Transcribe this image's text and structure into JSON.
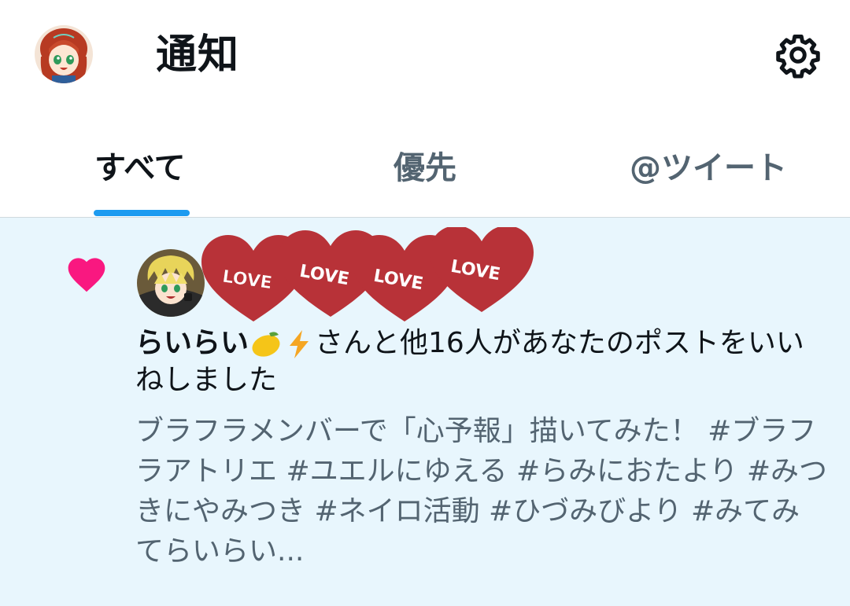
{
  "header": {
    "title": "通知",
    "profile_avatar_icon": "profile-avatar",
    "settings_icon": "gear-icon"
  },
  "tabs": [
    {
      "label": "すべて",
      "active": true
    },
    {
      "label": "優先",
      "active": false
    },
    {
      "label": "@ツイート",
      "active": false
    }
  ],
  "notification": {
    "type_icon": "heart-icon",
    "type_color": "#f91880",
    "liker_name": "らいらい",
    "liker_emojis": [
      "lemon-icon",
      "lightning-icon"
    ],
    "summary_suffix": "さんと他16人があなたのポストをいいねしました",
    "avatar_stickers": [
      "LOVE",
      "LOVE",
      "LOVE",
      "LOVE"
    ],
    "post_preview": "ブラフラメンバーで「心予報」描いてみた！ #ブラフラアトリエ #ユエルにゆえる #らみにおたより #みつきにやみつき #ネイロ活動 #ひづみびより #みてみてらいらい..."
  },
  "colors": {
    "accent": "#1d9bf0",
    "like": "#f91880",
    "unread_bg": "#e8f6fd",
    "text_primary": "#0f1419",
    "text_secondary": "#536471"
  }
}
